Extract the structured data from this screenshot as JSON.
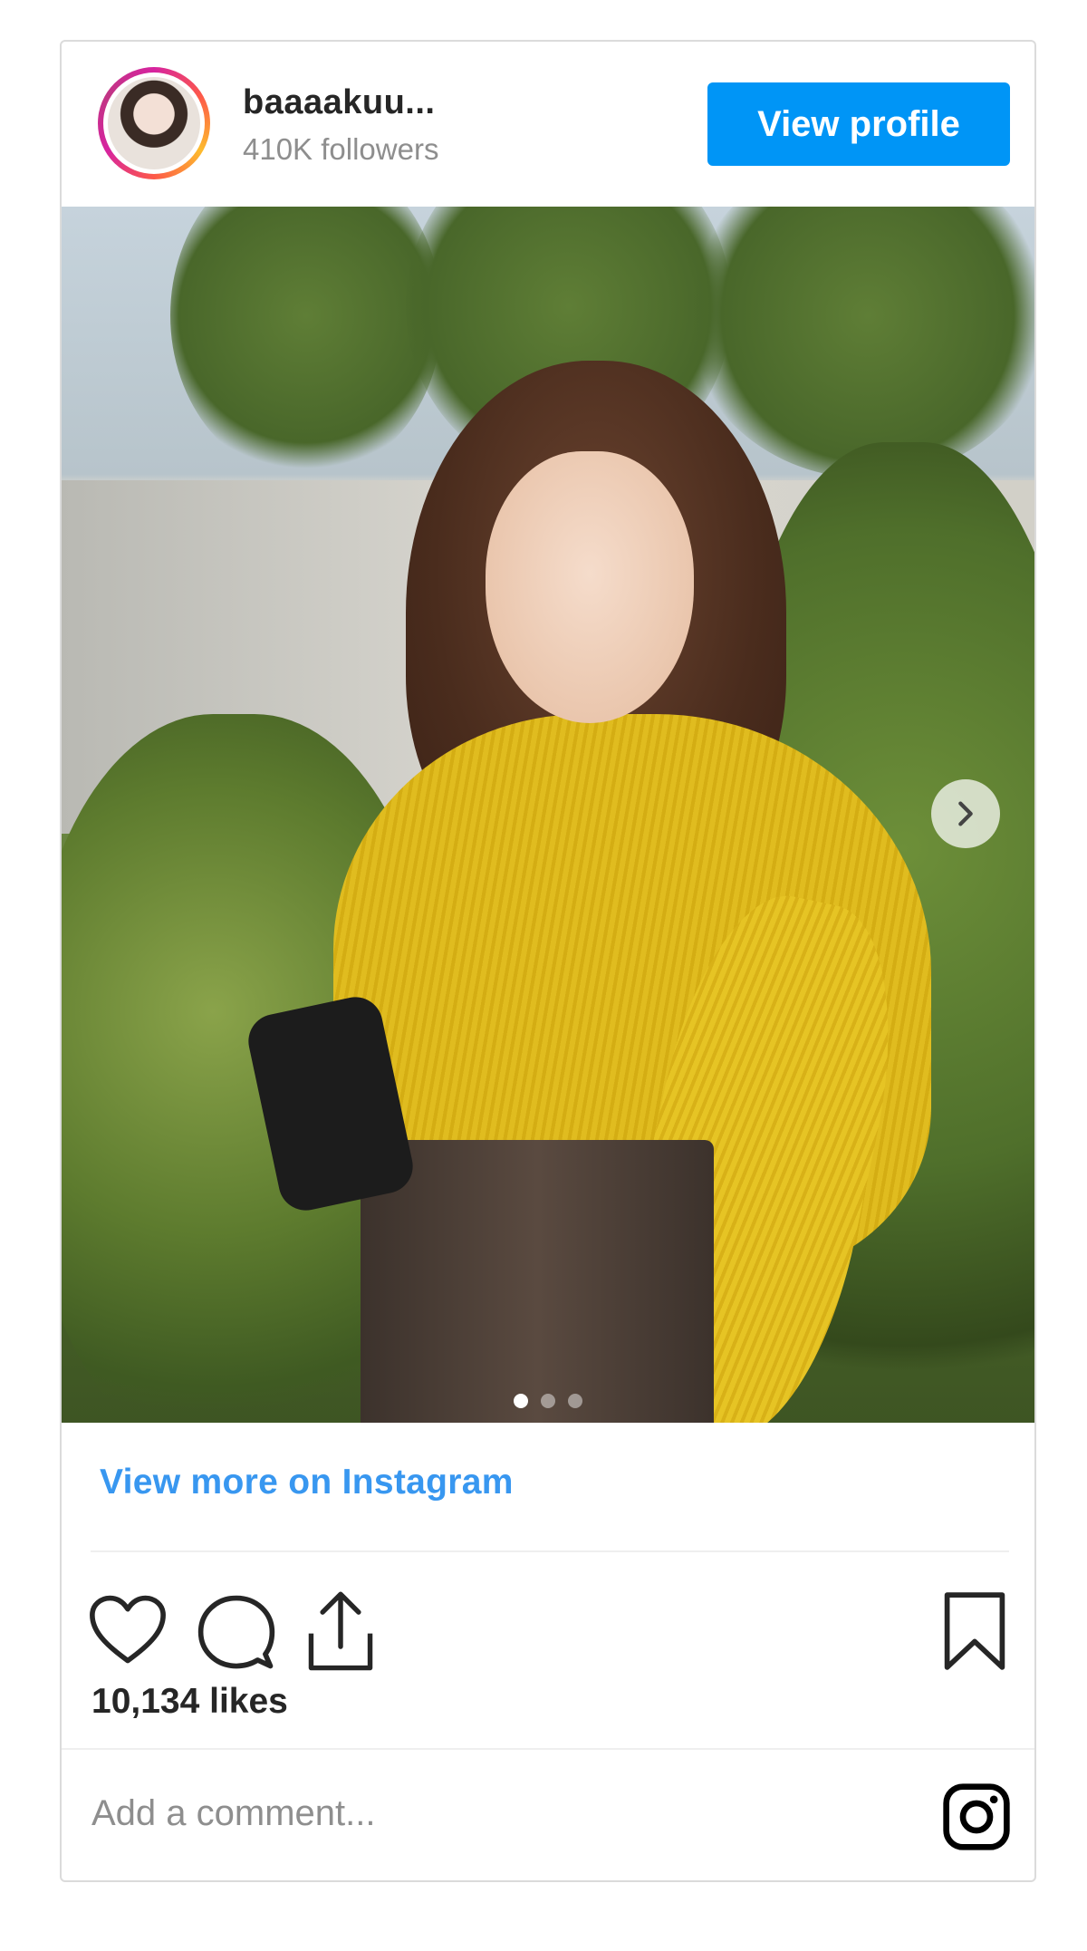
{
  "post": {
    "username": "baaaakuu...",
    "followers": "410K followers",
    "view_profile_label": "View profile",
    "view_more_label": "View more on Instagram",
    "likes": "10,134 likes",
    "comment_placeholder": "Add a comment...",
    "carousel": {
      "total_slides": 3,
      "active_slide": 1
    }
  },
  "icons": {
    "avatar": "avatar-photo",
    "like": "heart-icon",
    "comment": "comment-bubble-icon",
    "share": "share-upload-icon",
    "save": "bookmark-icon",
    "next": "chevron-right-icon",
    "logo": "instagram-logo-icon"
  },
  "colors": {
    "accent": "#0095f6",
    "link": "#3897f0",
    "text": "#262626",
    "muted": "#8e8e8e",
    "border": "#dbdbdb"
  }
}
